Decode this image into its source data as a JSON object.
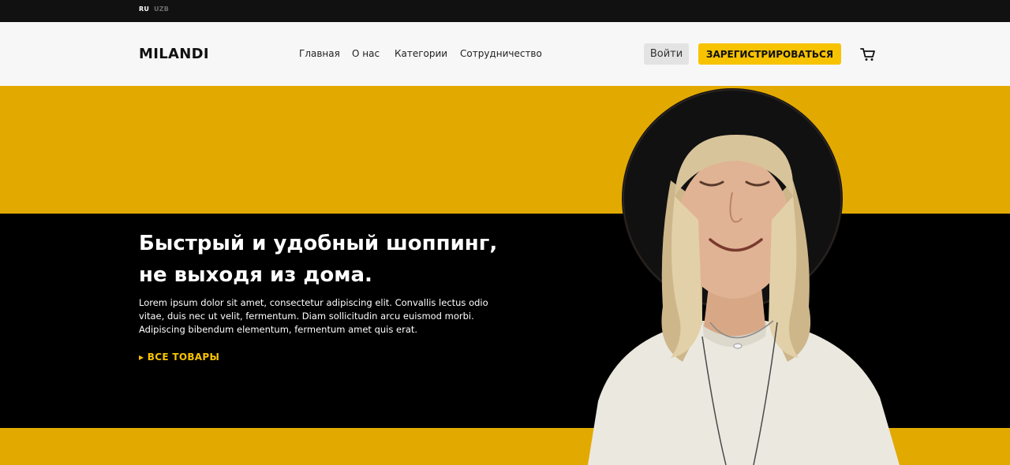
{
  "colors": {
    "accent": "#f7c300",
    "band": "#e2a900",
    "dark": "#000000"
  },
  "lang": {
    "active": "RU",
    "other": "UZB"
  },
  "header": {
    "logo": "MILANDI",
    "nav": [
      "Главная",
      "О нас",
      "Категории",
      "Сотрудничество"
    ],
    "login_label": "Войти",
    "register_label": "ЗАРЕГИСТРИРОВАТЬСЯ",
    "cart_icon": "cart-icon"
  },
  "hero": {
    "title_line1": "Быстрый и удобный шоппинг,",
    "title_line2": "не выходя из дома.",
    "text_line1": "Lorem ipsum dolor sit amet, consectetur adipiscing elit. Convallis lectus odio",
    "text_line2": "vitae, duis nec ut velit, fermentum. Diam sollicitudin arcu euismod morbi.",
    "text_line3": "Adipiscing bibendum elementum, fermentum amet quis erat.",
    "link_label": "▸ ВСЕ ТОВАРЫ"
  }
}
